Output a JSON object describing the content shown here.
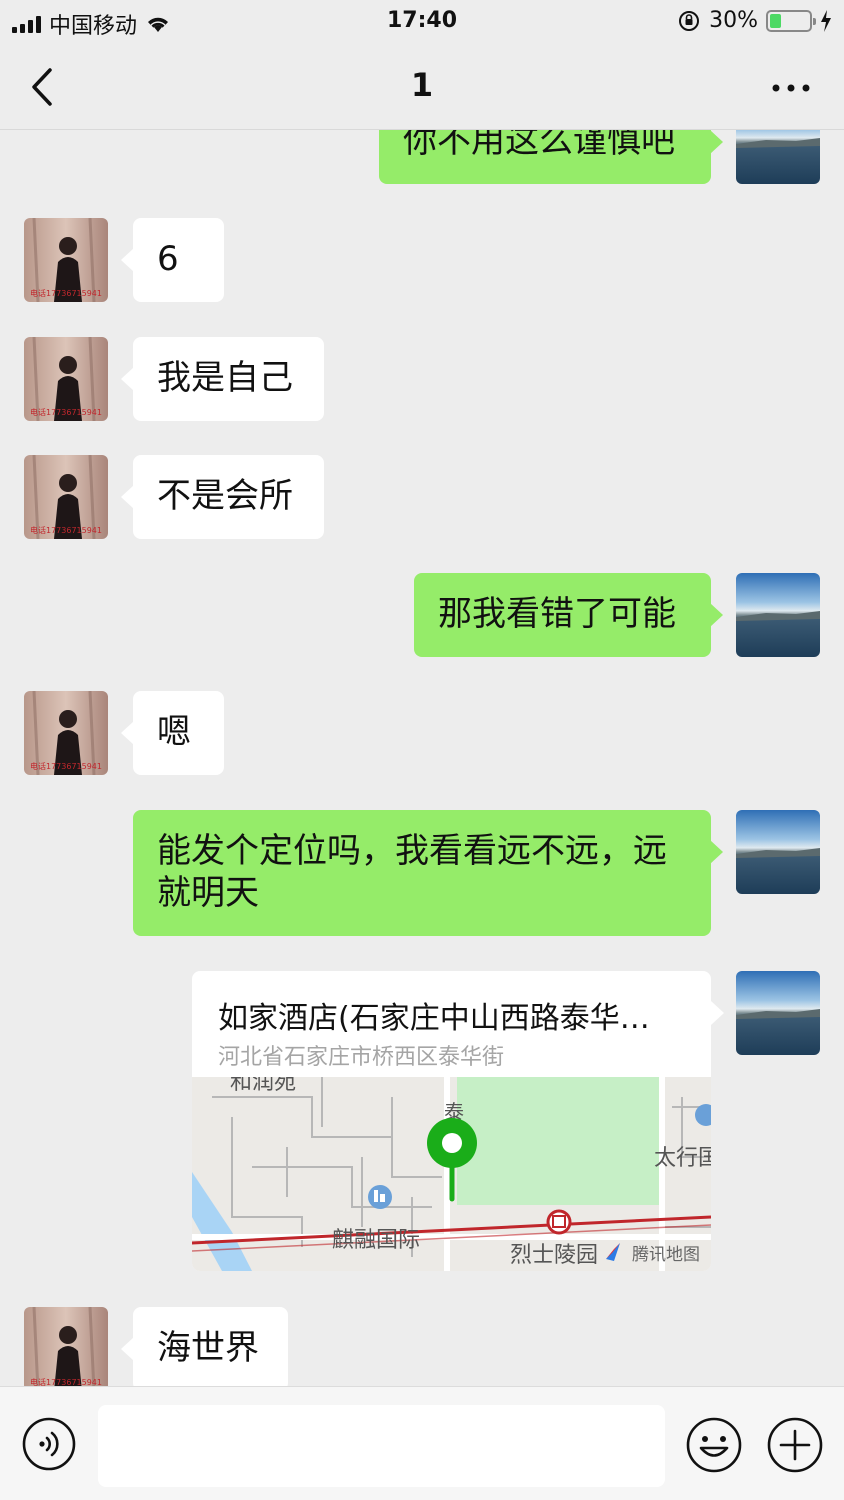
{
  "status_bar": {
    "carrier": "中国移动",
    "time": "17:40",
    "battery": "30%",
    "battery_level": 0.3
  },
  "nav": {
    "title": "1",
    "back_icon": "chevron-left-icon",
    "more_icon": "ellipsis-icon"
  },
  "messages": [
    {
      "side": "right",
      "type": "text",
      "text": "你不用这么谨慎吧"
    },
    {
      "side": "left",
      "type": "text",
      "text": "6"
    },
    {
      "side": "left",
      "type": "text",
      "text": "我是自己"
    },
    {
      "side": "left",
      "type": "text",
      "text": "不是会所"
    },
    {
      "side": "right",
      "type": "text",
      "text": "那我看错了可能"
    },
    {
      "side": "left",
      "type": "text",
      "text": "嗯"
    },
    {
      "side": "right",
      "type": "text",
      "text": "能发个定位吗，我看看远不远，远就明天"
    },
    {
      "side": "right",
      "type": "location",
      "title": "如家酒店(石家庄中山西路泰华街店)",
      "address": "河北省石家庄市桥西区泰华街",
      "map_labels": {
        "top": "和润苑",
        "street": "泰",
        "right": "太行国",
        "bottom_left": "麒融国际",
        "bottom_mid": "烈士陵园",
        "provider": "腾讯地图"
      }
    },
    {
      "side": "left",
      "type": "text",
      "text": "海世界"
    }
  ],
  "avatar_watermark": "电话17736715941",
  "input_bar": {
    "placeholder": "",
    "voice_icon": "voice-icon",
    "emoji_icon": "emoji-icon",
    "plus_icon": "plus-circle-icon"
  },
  "colors": {
    "background": "#ededed",
    "green_bubble": "#95ec69",
    "white_bubble": "#ffffff",
    "map_pin": "#1aad19"
  }
}
